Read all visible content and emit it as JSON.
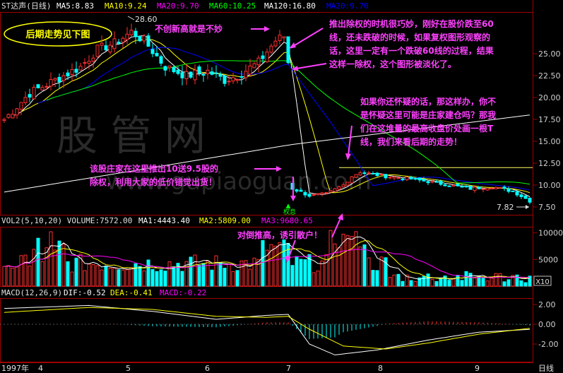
{
  "header": {
    "ticker": "ST达声(日线)",
    "ma5": "MA5:8.83",
    "ma10": "MA10:9.24",
    "ma20": "MA20:9.70",
    "ma60": "MA60:10.25",
    "ma120": "MA120:16.80",
    "ma20b": "MA20:9.70"
  },
  "vol_header": {
    "vol": "VOL2(5,10,20) VOLUME:7572.00",
    "ma1": "MA1:4443.40",
    "ma2": "MA2:5809.00",
    "ma3": "MA3:9680.65"
  },
  "macd_header": {
    "macd": "MACD(12,26,9)",
    "dif": "DIF:-0.52",
    "dea": "DEA:-0.41",
    "macdv": "MACD:-0.22"
  },
  "badge": {
    "text": "后期走势见下图"
  },
  "annotations": {
    "a1": "不创新高就是不妙",
    "a2_l1": "推出除权的时机很巧妙，刚好在股价跌至60",
    "a2_l2": "线，还未跌破的时候，如果复权图形观察的",
    "a2_l3": "话，这里一定有一个跌破60线的过程，结果",
    "a2_l4": "这样一除权，这个图形被淡化了。",
    "a3_l1": "如果你还怀疑的话，那这样办，你不",
    "a3_l2": "是怀疑这里可能是庄家建仓吗？那我",
    "a3_l3": "们在这堆量的最高收盘价处画一根T",
    "a3_l4": "线，我们来看后期的走势！",
    "a4_l1": "该股庄家在这里推出10送9.5股的",
    "a4_l2": "除权，利用大家的低价错觉出货！",
    "a5": "对倒推高，诱引散户！",
    "exright": "权息",
    "high_label": "28.60",
    "low_label": "7.82"
  },
  "watermark": {
    "cn": "股 管 网",
    "url": "www.gupiaoguan.com"
  },
  "x_axis": {
    "year": "1997年",
    "months": [
      "4",
      "5",
      "6",
      "7",
      "8",
      "9"
    ],
    "period": "日线",
    "x10": "X10"
  },
  "chart_data": [
    {
      "type": "candlestick",
      "title": "ST达声(日线)",
      "y_axis_labels": [
        "25.00",
        "22.50",
        "20.00",
        "17.50",
        "15.00",
        "12.50",
        "10.00",
        "7.50"
      ],
      "ylim": [
        7.0,
        29.5
      ],
      "annotated_values": {
        "high": 28.6,
        "last_low": 7.82,
        "t_line": 12.0
      },
      "series": [
        {
          "name": "MA5",
          "color": "#ffffff"
        },
        {
          "name": "MA10",
          "color": "#ffff00"
        },
        {
          "name": "MA20",
          "color": "#ff00ff"
        },
        {
          "name": "MA60",
          "color": "#00ff00"
        },
        {
          "name": "MA120",
          "color": "#ffffff"
        },
        {
          "name": "MA20",
          "color": "#0000ff"
        }
      ]
    },
    {
      "type": "bar",
      "title": "VOL2(5,10,20)",
      "y_axis_labels": [
        "10000",
        "5000"
      ],
      "ylim": [
        0,
        11000
      ],
      "values": {
        "VOLUME": 7572.0,
        "MA1": 4443.4,
        "MA2": 5809.0,
        "MA3": 9680.65
      }
    },
    {
      "type": "bar",
      "title": "MACD(12,26,9)",
      "y_axis_labels": [
        "2.00",
        "0.00",
        "-2.00"
      ],
      "ylim": [
        -3.5,
        3.0
      ],
      "values": {
        "DIF": -0.52,
        "DEA": -0.41,
        "MACD": -0.22
      }
    }
  ]
}
